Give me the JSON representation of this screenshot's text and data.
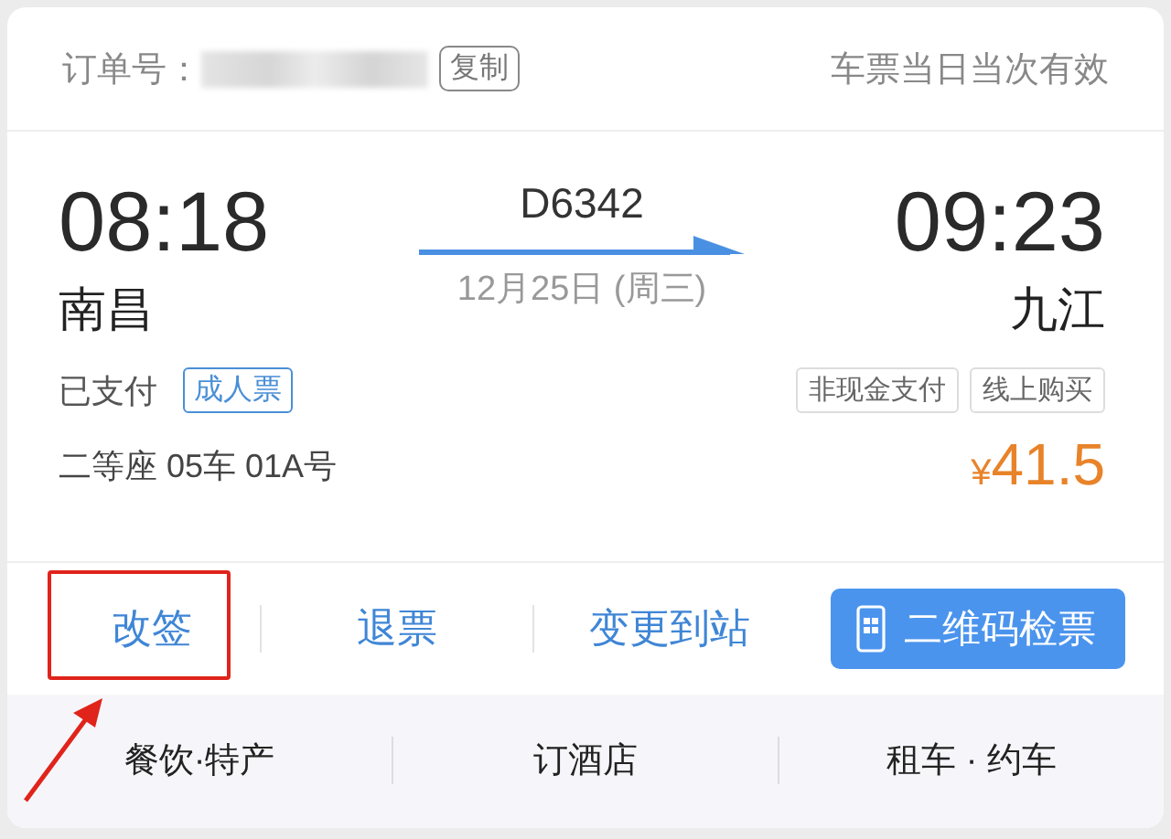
{
  "order": {
    "label": "订单号：",
    "copy_button": "复制",
    "validity": "车票当日当次有效"
  },
  "trip": {
    "depart_time": "08:18",
    "depart_station": "南昌",
    "train": "D6342",
    "date": "12月25日 (周三)",
    "arrive_time": "09:23",
    "arrive_station": "九江"
  },
  "payment": {
    "status": "已支付",
    "ticket_type": "成人票",
    "tags": [
      "非现金支付",
      "线上购买"
    ]
  },
  "seat": "二等座 05车 01A号",
  "price": {
    "symbol": "¥",
    "amount": "41.5"
  },
  "actions": [
    {
      "label": "改签",
      "kind": "link",
      "highlighted": true
    },
    {
      "label": "退票",
      "kind": "link",
      "highlighted": false
    },
    {
      "label": "变更到站",
      "kind": "link",
      "highlighted": false
    },
    {
      "label": "二维码检票",
      "kind": "primary",
      "highlighted": false
    }
  ],
  "services": [
    "餐饮·特产",
    "订酒店",
    "租车 · 约车"
  ]
}
